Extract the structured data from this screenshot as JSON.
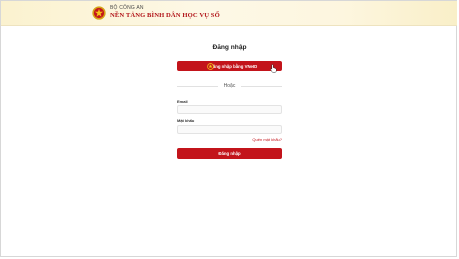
{
  "header": {
    "ministry": "BỘ CÔNG AN",
    "platform_title": "NỀN TẢNG BÌNH DÂN HỌC VỤ SỐ",
    "emblem_icon": "police-emblem-icon"
  },
  "login": {
    "title": "Đăng nhập",
    "vneid_button_label": "Đăng nhập bằng VNeID",
    "or_text": "Hoặc",
    "email_label": "Email",
    "email_value": "",
    "password_label": "Mật khẩu",
    "password_value": "",
    "forgot_password": "Quên mật khẩu?",
    "submit_label": "Đăng nhập"
  },
  "colors": {
    "primary_red": "#c3141b",
    "header_gold": "#fbf2cf"
  }
}
